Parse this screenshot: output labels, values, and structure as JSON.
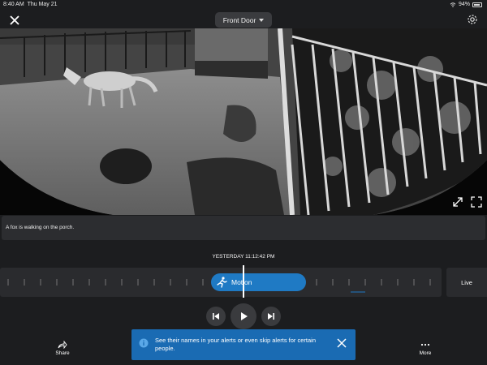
{
  "status_bar": {
    "time": "8:40 AM",
    "date": "Thu May 21",
    "battery": "94%"
  },
  "header": {
    "camera_name": "Front Door"
  },
  "caption": {
    "text": "A fox is walking on the porch."
  },
  "timeline": {
    "timestamp": "YESTERDAY 11:12:42 PM",
    "event_label": "Motion",
    "live_label": "Live"
  },
  "actions": {
    "share_label": "Share",
    "more_label": "More"
  },
  "banner": {
    "text": "See their names in your alerts or even skip alerts for certain people."
  },
  "colors": {
    "accent": "#1f7ac4",
    "banner": "#1a6bb3",
    "panel": "#2a2b2e",
    "background": "#1c1d1f"
  }
}
